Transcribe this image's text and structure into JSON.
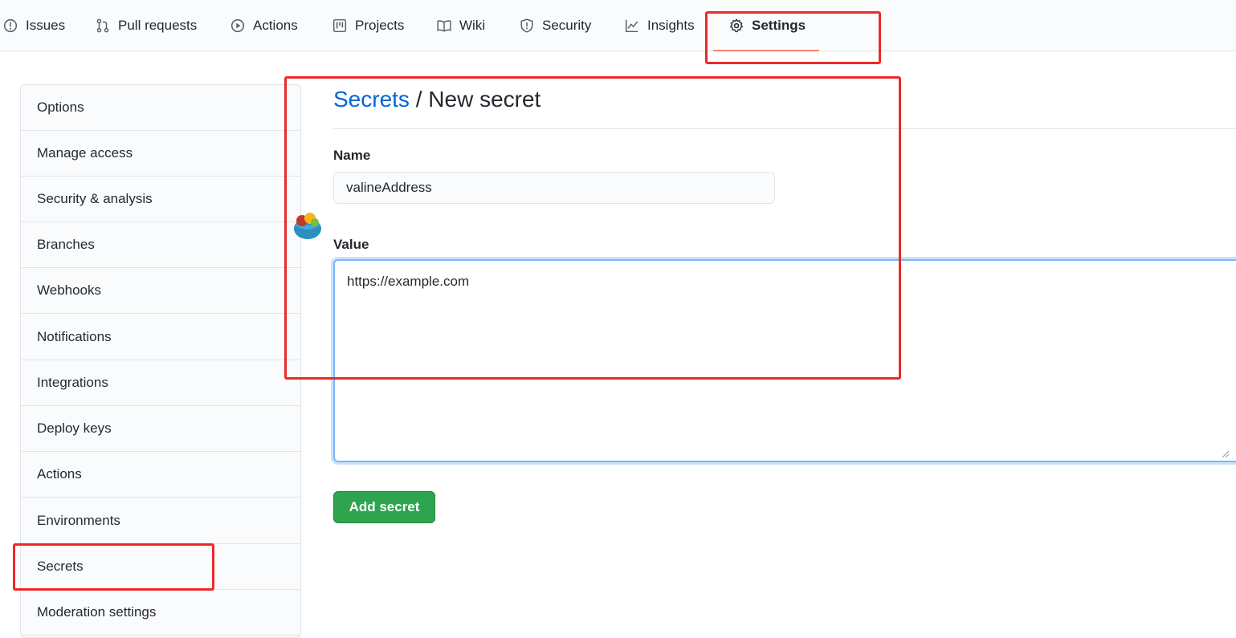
{
  "nav": {
    "tabs": [
      {
        "label": "Issues",
        "icon": "issue-icon"
      },
      {
        "label": "Pull requests",
        "icon": "pull-request-icon"
      },
      {
        "label": "Actions",
        "icon": "play-icon"
      },
      {
        "label": "Projects",
        "icon": "project-icon"
      },
      {
        "label": "Wiki",
        "icon": "book-icon"
      },
      {
        "label": "Security",
        "icon": "shield-icon"
      },
      {
        "label": "Insights",
        "icon": "graph-icon"
      },
      {
        "label": "Settings",
        "icon": "gear-icon",
        "active": true
      }
    ]
  },
  "sidebar": {
    "items": [
      {
        "label": "Options"
      },
      {
        "label": "Manage access"
      },
      {
        "label": "Security & analysis"
      },
      {
        "label": "Branches"
      },
      {
        "label": "Webhooks"
      },
      {
        "label": "Notifications"
      },
      {
        "label": "Integrations"
      },
      {
        "label": "Deploy keys"
      },
      {
        "label": "Actions"
      },
      {
        "label": "Environments"
      },
      {
        "label": "Secrets"
      },
      {
        "label": "Moderation settings"
      }
    ]
  },
  "main": {
    "breadcrumb_link": "Secrets",
    "breadcrumb_sep": " / ",
    "title": "New secret",
    "name_label": "Name",
    "name_value": "valineAddress",
    "value_label": "Value",
    "value_text": "https://example.com",
    "submit_label": "Add secret"
  },
  "colors": {
    "accent_link": "#0366d6",
    "button_green": "#2ea44f",
    "annotation_red": "#ea2a2a",
    "tab_underline": "#f9826c"
  }
}
